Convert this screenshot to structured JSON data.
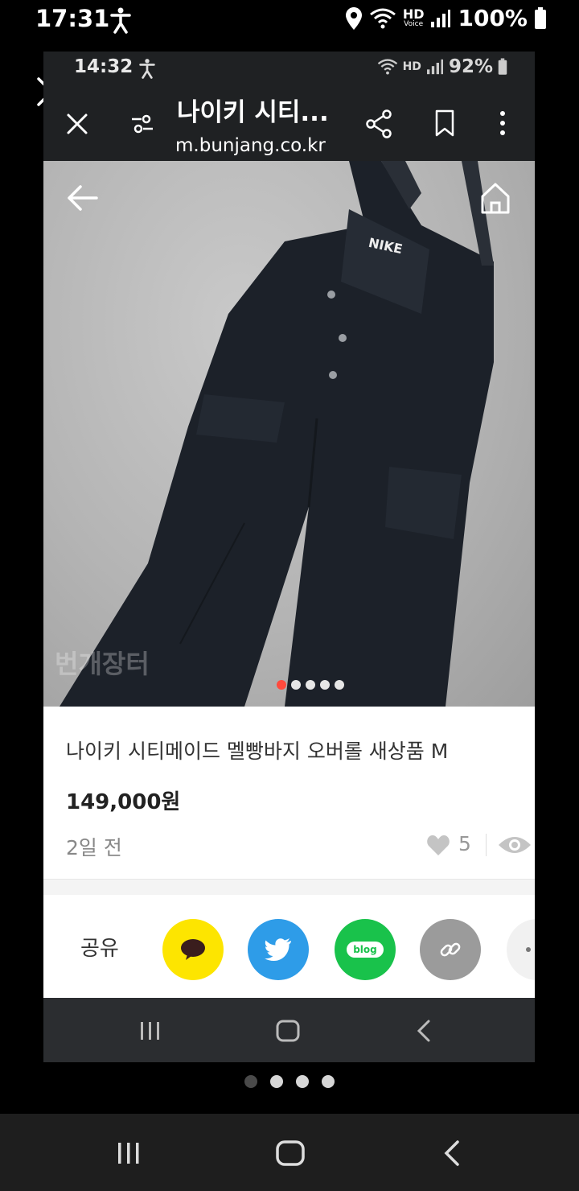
{
  "outer_status": {
    "time": "17:31",
    "hd_label": "HD",
    "hd_sub": "Voice",
    "battery": "100%"
  },
  "inner_status": {
    "time": "14:32",
    "hd_label": "HD",
    "battery": "92%"
  },
  "browser": {
    "tab_title": "나이키 시티...",
    "url": "m.bunjang.co.kr"
  },
  "product": {
    "image_watermark": "번개장터",
    "image_logo_text": "NIKE",
    "image_pager": {
      "count": 5,
      "active_index": 0
    },
    "title": "나이키 시티메이드 멜빵바지 오버롤 새상품 M",
    "price": "149,000원",
    "posted": "2일 전",
    "likes": "5"
  },
  "share": {
    "label": "공유",
    "items": [
      {
        "name": "kakaotalk",
        "color": "#fde500"
      },
      {
        "name": "twitter",
        "color": "#2e9ce8"
      },
      {
        "name": "naver-blog",
        "color": "#19c24b",
        "text": "blog"
      },
      {
        "name": "copy-link",
        "color": "#9b9b9b"
      },
      {
        "name": "more",
        "color": "#f1f1f1"
      }
    ]
  },
  "gallery": {
    "count": 4,
    "active_index": 0
  }
}
